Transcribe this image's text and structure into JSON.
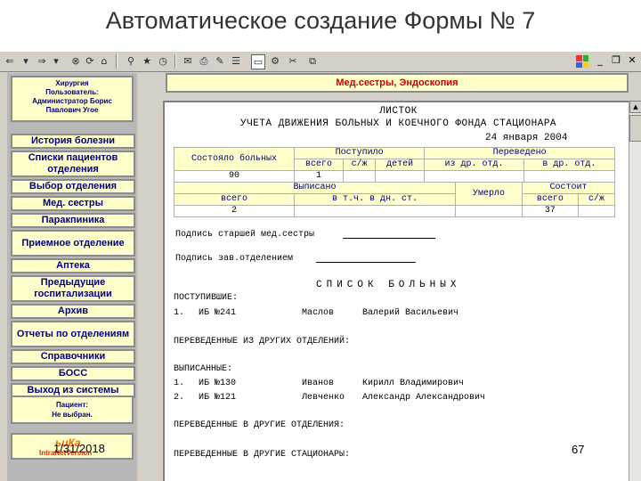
{
  "slide_title": "Автоматическое создание Формы № 7",
  "toolbar": {
    "icons": [
      "back-icon",
      "forward-icon",
      "stop-icon",
      "refresh-icon",
      "home-icon",
      "search-icon",
      "favorites-icon",
      "history-icon",
      "mail-icon",
      "print-icon",
      "edit-icon",
      "discuss-icon",
      "messenger-icon",
      "cut-icon",
      "copy-icon"
    ]
  },
  "user": {
    "role": "Хирургия",
    "label": "Пользователь:",
    "name": "Администратор Борис",
    "name2": "Павлович Угое"
  },
  "menu": [
    "История болезни",
    "Списки пациентов отделения",
    "Выбор отделения",
    "Мед. сестры",
    "Паракпиника",
    "Приемное отделение",
    "Аптека",
    "Предыдущие госпитализации",
    "Архив",
    "Отчеты по отделениям",
    "Справочники",
    "БОСС",
    "Выход из системы"
  ],
  "patient": {
    "label": "Пациент:",
    "value": "Не выбран."
  },
  "logo": {
    "top": "ьиКа",
    "bottom": "IntraNetVersion"
  },
  "slide_date": "1/31/2018",
  "slide_page": "67",
  "banner": "Мед.сестры, Эндоскопия",
  "doc": {
    "title1": "ЛИСТОК",
    "title2": "УЧЕТА ДВИЖЕНИЯ БОЛЬНЫХ И КОЕЧНОГО ФОНДА СТАЦИОНАРА",
    "date": "24 января 2004",
    "table1": {
      "h_state": "Состояло больных",
      "h_admitted": "Поступило",
      "h_transferred": "Переведено",
      "h_total": "всего",
      "h_sj": "с/ж",
      "h_children": "детей",
      "h_from": "из др. отд.",
      "h_to": "в др. отд.",
      "v_state": "90",
      "v_total": "1"
    },
    "table2": {
      "h_discharged": "Выписано",
      "h_died": "Умерло",
      "h_remain": "Состоит",
      "h_total": "всего",
      "h_day": "в т.ч. в дн. ст.",
      "h_total2": "всего",
      "h_sj": "с/ж",
      "v_discharged": "2",
      "v_remain": "37"
    },
    "sig_nurse": "Подпись старшей мед.сестры",
    "sig_head": "Подпись зав.отделением",
    "list_title": "СПИСОК БОЛЬНЫХ",
    "sec_admitted": "ПОСТУПИВШИЕ:",
    "admitted": [
      {
        "n": "1.",
        "ib": "ИБ №241",
        "last": "Маслов",
        "first": "Валерий Васильевич"
      }
    ],
    "sec_from_other": "ПЕРЕВЕДЕННЫЕ ИЗ ДРУГИХ ОТДЕЛЕНИЙ:",
    "sec_discharged": "ВЫПИСАННЫЕ:",
    "discharged": [
      {
        "n": "1.",
        "ib": "ИБ №130",
        "last": "Иванов",
        "first": "Кирилл Владимирович"
      },
      {
        "n": "2.",
        "ib": "ИБ №121",
        "last": "Левченко",
        "first": "Александр Александрович"
      }
    ],
    "sec_to_other": "ПЕРЕВЕДЕННЫЕ В ДРУГИЕ ОТДЕЛЕНИЯ:",
    "sec_to_hosp": "ПЕРЕВЕДЕННЫЕ В ДРУГИЕ СТАЦИОНАРЫ:"
  }
}
